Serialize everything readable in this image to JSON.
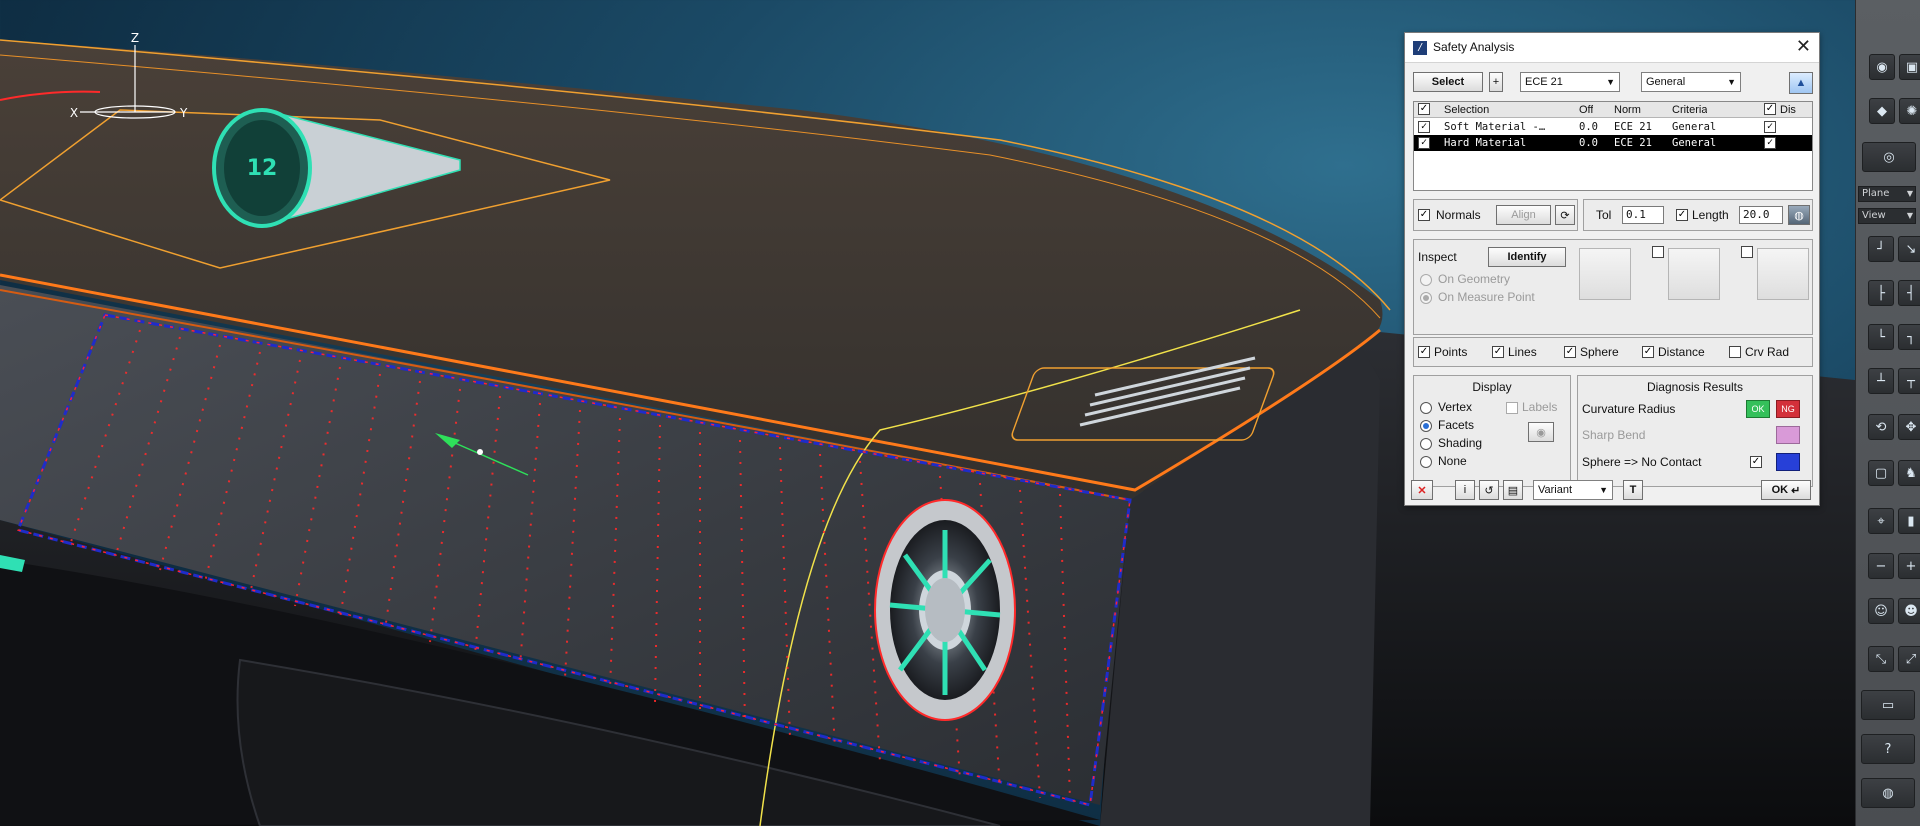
{
  "axis": {
    "z": "Z",
    "x": "X",
    "y": "Y"
  },
  "dialog": {
    "title": "Safety Analysis",
    "select_label": "Select",
    "plus_label": "+",
    "norm_value": "ECE 21",
    "criteria_value": "General",
    "table": {
      "headers": [
        "Selection",
        "Off",
        "Norm",
        "Criteria",
        "Dis"
      ],
      "rows": [
        {
          "selection": "Soft Material -…",
          "off": "0.0",
          "norm": "ECE 21",
          "criteria": "General",
          "checked": true,
          "display": true,
          "selected": false
        },
        {
          "selection": "Hard Material",
          "off": "0.0",
          "norm": "ECE 21",
          "criteria": "General",
          "checked": true,
          "display": true,
          "selected": true
        }
      ]
    },
    "normals_label": "Normals",
    "align_label": "Align",
    "tol_label": "Tol",
    "tol_value": "0.1",
    "length_label": "Length",
    "length_value": "20.0",
    "inspect_label": "Inspect",
    "identify_label": "Identify",
    "on_geometry_label": "On Geometry",
    "on_measure_point_label": "On Measure Point",
    "points_label": "Points",
    "lines_label": "Lines",
    "sphere_label": "Sphere",
    "distance_label": "Distance",
    "crv_rad_label": "Crv Rad",
    "display_title": "Display",
    "vertex_label": "Vertex",
    "facets_label": "Facets",
    "shading_label": "Shading",
    "none_label": "None",
    "labels_label": "Labels",
    "diagnosis_title": "Diagnosis Results",
    "curvature_radius_label": "Curvature Radius",
    "ok_swatch": "OK",
    "nok_swatch": "NG",
    "sharp_bend_label": "Sharp Bend",
    "sphere_no_contact_label": "Sphere => No Contact",
    "variant_value": "Variant",
    "ok_label": "OK"
  },
  "toolbar": {
    "plane_value": "Plane",
    "view_value": "View"
  },
  "colors": {
    "accent": "#2a6fd6",
    "ok_green": "#34c05a",
    "nok_red": "#d3303a",
    "sharp_pink": "#d99ad8",
    "sphere_blue": "#2740d8"
  }
}
